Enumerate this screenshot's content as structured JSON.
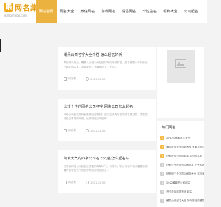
{
  "site": {
    "logo_mark": "集",
    "logo_name": "网名集",
    "logo_domain": "wangmingji.com"
  },
  "nav": {
    "items": [
      "网站首页",
      "网名大全",
      "微信网名",
      "游戏网名",
      "情侣网名",
      "个性签名",
      "昵称大全",
      "公司起名"
    ],
    "active_index": 0
  },
  "articles": [
    {
      "title": "潮汛公司名字大全个性 怎么起名好听",
      "summary": "寿光潮汛行业，需要人去做公司起名好听的新颖的名，起名需要一个好的自己喜欢的名字，发展更好，有重要意义，下同...",
      "tag": "网名集",
      "date": "2021-12-03"
    },
    {
      "title": "比较个性的网络公司名字 网络公司怎么起名",
      "summary": "网络公司起名规则就是要选好做好，起名应该有好名字网名集好的，发展更好应该有好的网络，给新网络公司名称...",
      "tag": "网名集",
      "date": "2021-12-03"
    },
    {
      "title": "简单大气的四字公司名 公司名怎么起名好",
      "summary": "四字名称给公司起名应该要的简单大气，有意义，字公司名字含义重要的需要有名字的大气的名字好的那些名字含...",
      "tag": "网名集",
      "date": "2021-12-03"
    }
  ],
  "hot": {
    "title": "热门网名",
    "items": [
      "2017公司取名字大全",
      "寓意好的企业取名大全 有寓意的公司名字",
      "比较好的公司取名字 吉利的名字",
      "比较正气好听的公司名字 正气的名字",
      "好听的三个字的公司名大全 吉利字公司名",
      "2022最新的公司起名",
      "开个洗衣店好不好 起名",
      "餐饮公司起名大全 好听好记的餐饮..."
    ]
  },
  "colors": {
    "accent": "#ecb23f",
    "logo_gold": "#e6a11a",
    "page_bg": "#f3f3f3"
  }
}
